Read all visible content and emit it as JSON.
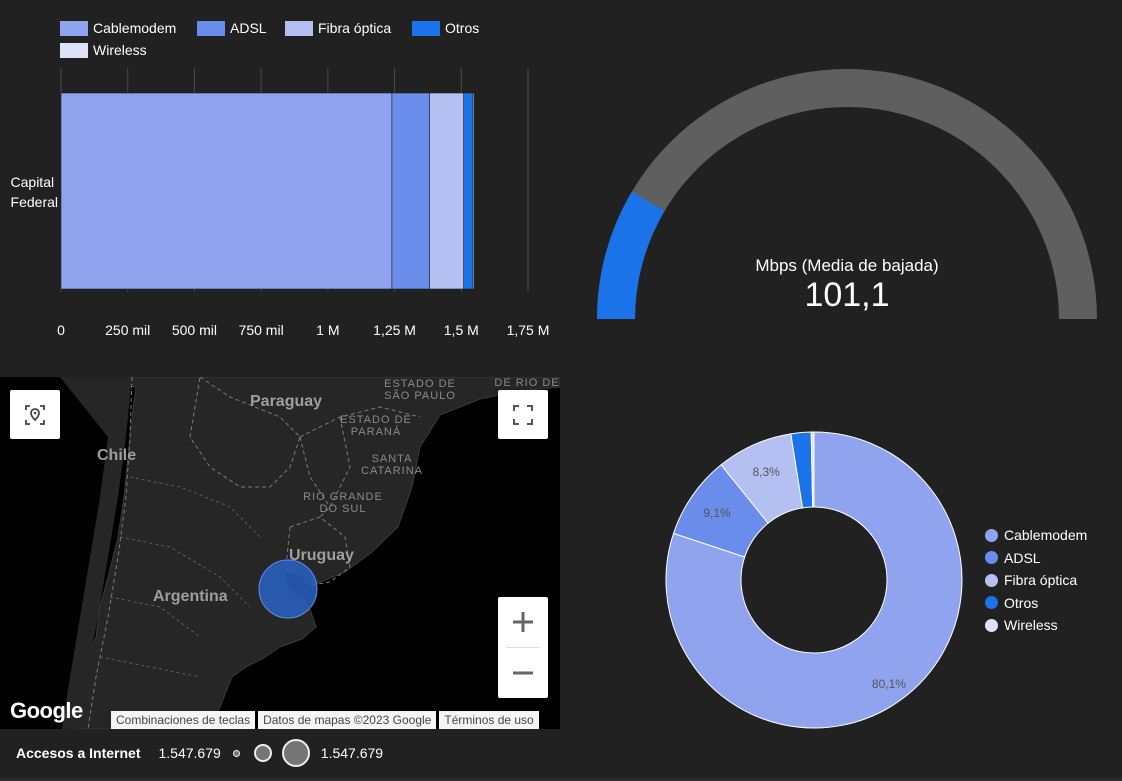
{
  "bar_chart": {
    "legend": [
      {
        "name": "Cablemodem",
        "color": "#8fa3ef"
      },
      {
        "name": "ADSL",
        "color": "#6a8deb"
      },
      {
        "name": "Fibra óptica",
        "color": "#b4c0f2"
      },
      {
        "name": "Otros",
        "color": "#1a73e8"
      },
      {
        "name": "Wireless",
        "color": "#dde2f7"
      }
    ]
  },
  "chart_data": [
    {
      "type": "bar",
      "orientation": "horizontal",
      "stacked": true,
      "categories": [
        "Capital Federal"
      ],
      "series": [
        {
          "name": "Cablemodem",
          "values": [
            1240000
          ],
          "color": "#8fa3ef"
        },
        {
          "name": "ADSL",
          "values": [
            141000
          ],
          "color": "#6a8deb"
        },
        {
          "name": "Fibra óptica",
          "values": [
            128000
          ],
          "color": "#b4c0f2"
        },
        {
          "name": "Otros",
          "values": [
            35000
          ],
          "color": "#1a73e8"
        },
        {
          "name": "Wireless",
          "values": [
            4000
          ],
          "color": "#dde2f7"
        }
      ],
      "xlim": [
        0,
        1750000
      ],
      "x_ticks": [
        "0",
        "250 mil",
        "500 mil",
        "750 mil",
        "1 M",
        "1,25 M",
        "1,5 M",
        "1,75 M"
      ],
      "grid": true,
      "legend_position": "top"
    },
    {
      "type": "gauge",
      "label": "Mbps (Media de bajada)",
      "value": "101,1",
      "fill_fraction": 0.17,
      "fill_color": "#1a73e8",
      "track_color": "#5f5f5f"
    },
    {
      "type": "pie",
      "donut": true,
      "slices": [
        {
          "name": "Cablemodem",
          "value": 80.1,
          "label": "80,1%",
          "color": "#8fa3ef"
        },
        {
          "name": "ADSL",
          "value": 9.1,
          "label": "9,1%",
          "color": "#6a8deb"
        },
        {
          "name": "Fibra óptica",
          "value": 8.3,
          "label": "8,3%",
          "color": "#b4c0f2"
        },
        {
          "name": "Otros",
          "value": 2.2,
          "label": "",
          "color": "#1a73e8"
        },
        {
          "name": "Wireless",
          "value": 0.3,
          "label": "",
          "color": "#dde2f7"
        }
      ],
      "legend_position": "right"
    }
  ],
  "gauge": {
    "label": "Mbps (Media de bajada)",
    "value": "101,1"
  },
  "map": {
    "labels": {
      "paraguay": "Paraguay",
      "chile": "Chile",
      "uruguay": "Uruguay",
      "argentina": "Argentina",
      "sao_paulo": "ESTADO DE SÃO PAULO",
      "rio": "DE RIO DE",
      "parana": "ESTADO DE PARANÁ",
      "santa_catarina": "SANTA CATARINA",
      "rio_grande": "RIO GRANDE DO SUL"
    },
    "footer": {
      "shortcuts": "Combinaciones de teclas",
      "map_data": "Datos de mapas ©2023 Google",
      "terms": "Términos de uso"
    },
    "logo": "Google",
    "icons": {
      "locate": "locate-icon",
      "fullscreen": "fullscreen-icon",
      "zoom_in": "plus-icon",
      "zoom_out": "minus-icon"
    }
  },
  "bubble_legend": {
    "title": "Accesos a Internet",
    "min_value": "1.547.679",
    "max_value": "1.547.679"
  },
  "donut_legend": [
    {
      "name": "Cablemodem",
      "color": "#8fa3ef"
    },
    {
      "name": "ADSL",
      "color": "#6a8deb"
    },
    {
      "name": "Fibra óptica",
      "color": "#b4c0f2"
    },
    {
      "name": "Otros",
      "color": "#1a73e8"
    },
    {
      "name": "Wireless",
      "color": "#dde2f7"
    }
  ]
}
